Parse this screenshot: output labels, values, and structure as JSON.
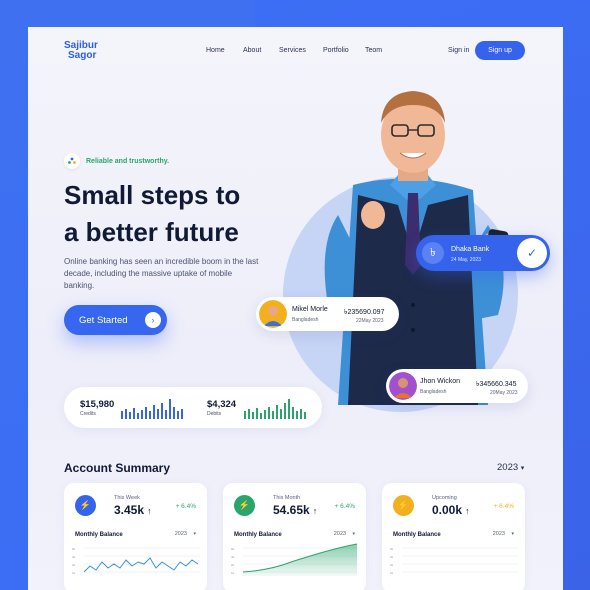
{
  "brand": {
    "line1": "Sajibur",
    "line2": "Sagor",
    "accent": "#3563ec"
  },
  "nav": {
    "items": [
      "Home",
      "About",
      "Services",
      "Portfolio",
      "Teom"
    ],
    "signin": "Sign in",
    "signup": "Sign up"
  },
  "hero": {
    "tagline": "Reliable and trustworthy.",
    "headline_line1": "Small steps to",
    "headline_line2": "a better future",
    "description": "Online banking has seen an incredible boom in the last decade, including the massive uptake of mobile banking.",
    "cta": "Get Started"
  },
  "stats": {
    "credits": {
      "value": "$15,980",
      "label": "Credits"
    },
    "debits": {
      "value": "$4,324",
      "label": "Debits"
    }
  },
  "transactions": [
    {
      "name": "Mikel Morle",
      "country": "Bangladesh",
      "amount": "৳235690.097",
      "date": "22May 2023"
    },
    {
      "name": "Jhon Wickon",
      "country": "Bangladesh",
      "amount": "৳345660.345",
      "date": "20May 2023"
    }
  ],
  "bank": {
    "name": "Dhaka Bank",
    "date": "24 May, 2023",
    "currency_icon": "taka-icon",
    "check_icon": "check-icon"
  },
  "account_summary": {
    "title": "Account Summary",
    "year": "2023",
    "cards": [
      {
        "label": "This Week",
        "value": "3.45k",
        "pct": "+ 6.4%",
        "color": "#3563ec",
        "pct_color": "#2aa56c",
        "chart_title": "Monthly Balance",
        "year": "2023",
        "icon": "lightning-icon"
      },
      {
        "label": "This Month",
        "value": "54.65k",
        "pct": "+ 6.4%",
        "color": "#2aa56c",
        "pct_color": "#2aa56c",
        "chart_title": "Monthly Balance",
        "year": "2023",
        "icon": "lightning-icon"
      },
      {
        "label": "Upcoming",
        "value": "0.00k",
        "pct": "+ 6.4%",
        "color": "#f2b01e",
        "pct_color": "#f2b01e",
        "chart_title": "Monthly Balance",
        "year": "2023",
        "icon": "lightning-icon"
      }
    ]
  }
}
